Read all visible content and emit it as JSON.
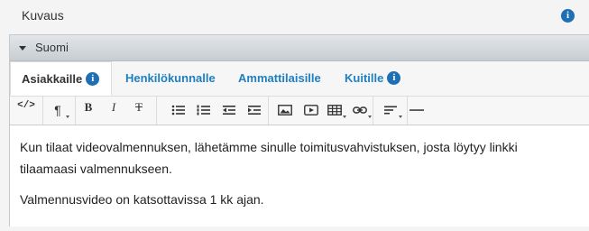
{
  "field": {
    "title": "Kuvaus",
    "info_icon": "info-icon"
  },
  "language": {
    "label": "Suomi"
  },
  "tabs": [
    {
      "label": "Asiakkaille",
      "active": true,
      "info": true
    },
    {
      "label": "Henkilökunnalle",
      "active": false,
      "info": false
    },
    {
      "label": "Ammattilaisille",
      "active": false,
      "info": false
    },
    {
      "label": "Kuitille",
      "active": false,
      "info": true
    }
  ],
  "toolbar": {
    "code": "</>",
    "paragraph": "¶",
    "bold": "B",
    "italic": "I",
    "strike": "T"
  },
  "editor": {
    "paragraph1": "Kun tilaat videovalmennuksen, lähetämme sinulle toimitusvahvistuksen, josta löytyy linkki tilaamaasi valmennukseen.",
    "paragraph2": "Valmennusvideo on katsottavissa 1 kk ajan."
  },
  "colors": {
    "accent": "#1f7fbf",
    "info": "#1e6fb4"
  }
}
